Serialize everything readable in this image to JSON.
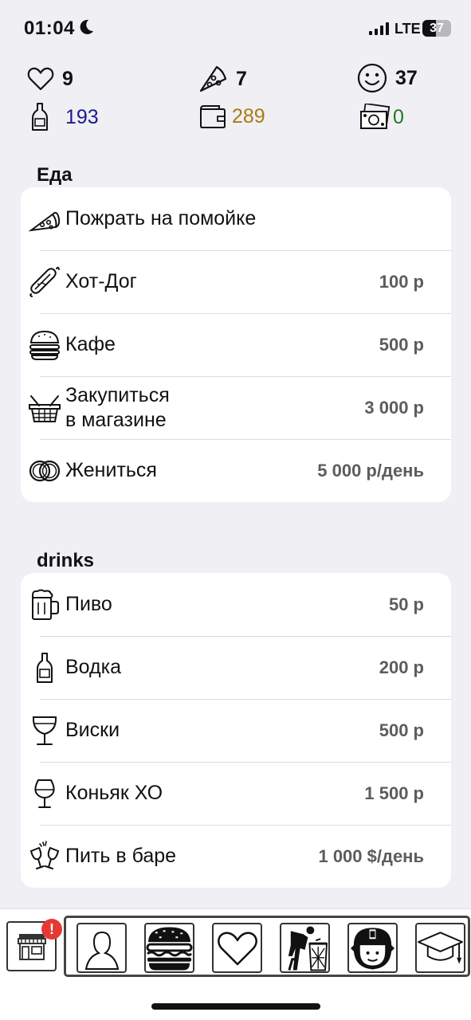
{
  "status_bar": {
    "time": "01:04",
    "network": "LTE",
    "battery": "37"
  },
  "stats": {
    "health": "9",
    "food": "7",
    "mood": "37",
    "alcohol": "193",
    "money": "289",
    "cash": "0"
  },
  "colors": {
    "alcohol": "#1a1a8c",
    "money": "#a87c12",
    "cash": "#1f7a1f",
    "badge": "#e53935"
  },
  "sections": {
    "food": {
      "title": "Еда",
      "items": [
        {
          "label": "Пожрать на помойке",
          "price": "",
          "icon": "pizza-slice-icon"
        },
        {
          "label": "Хот-Дог",
          "price": "100 р",
          "icon": "hotdog-icon"
        },
        {
          "label": "Кафе",
          "price": "500 р",
          "icon": "burger-icon"
        },
        {
          "label": "Закупиться\nв магазине",
          "price": "3 000 р",
          "icon": "shopping-basket-icon"
        },
        {
          "label": "Жениться",
          "price": "5 000 р/день",
          "icon": "wedding-rings-icon"
        }
      ]
    },
    "drinks": {
      "title": "drinks",
      "items": [
        {
          "label": "Пиво",
          "price": "50 р",
          "icon": "beer-mug-icon"
        },
        {
          "label": "Водка",
          "price": "200 р",
          "icon": "vodka-bottle-icon"
        },
        {
          "label": "Виски",
          "price": "500 р",
          "icon": "whisky-glass-icon"
        },
        {
          "label": "Коньяк ХО",
          "price": "1 500 р",
          "icon": "cognac-glass-icon"
        },
        {
          "label": "Пить в баре",
          "price": "1 000 $/день",
          "icon": "cheers-glasses-icon"
        }
      ]
    }
  },
  "bottom_bar": {
    "badge": "!",
    "tabs": [
      "profile-icon",
      "burger-icon",
      "heart-icon",
      "trash-person-icon",
      "firefighter-icon",
      "graduation-cap-icon"
    ]
  }
}
